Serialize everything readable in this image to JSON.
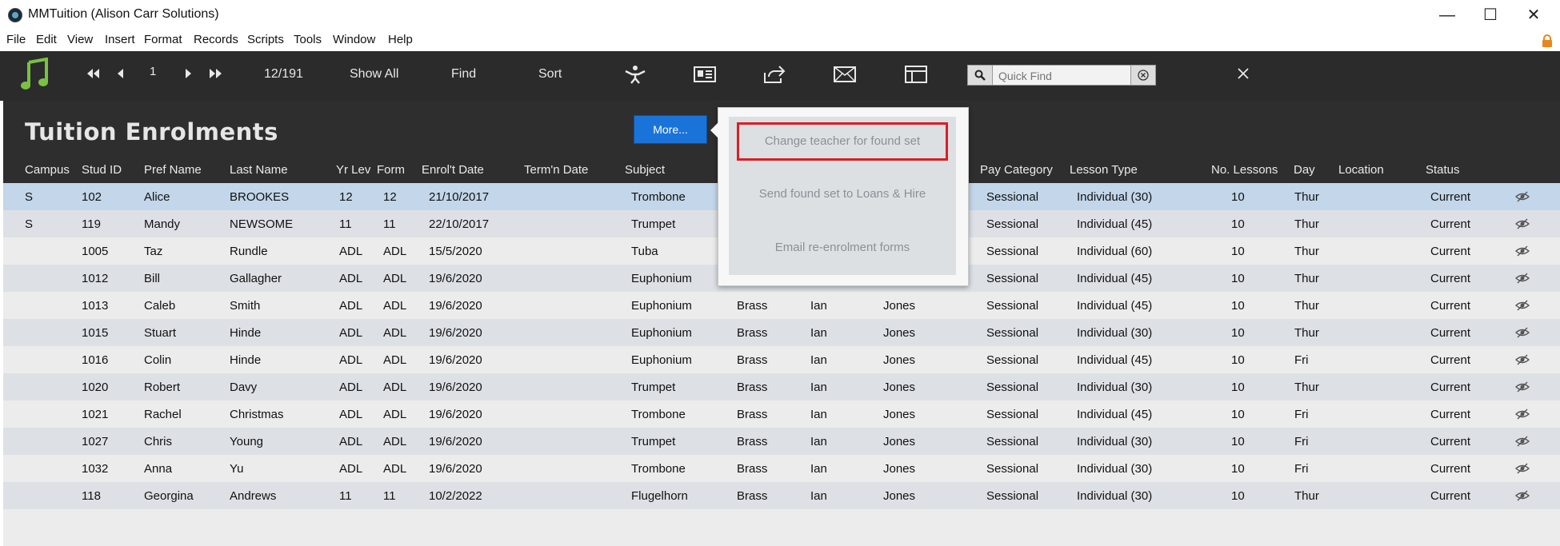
{
  "window": {
    "title": "MMTuition (Alison Carr Solutions)",
    "controls": {
      "minimize": "—",
      "maximize": "☐",
      "close": "✕"
    }
  },
  "menu": {
    "items": [
      "File",
      "Edit",
      "View",
      "Insert",
      "Format",
      "Records",
      "Scripts",
      "Tools",
      "Window",
      "Help"
    ]
  },
  "toolbar": {
    "record_number": "1",
    "record_count": "12/191",
    "show_all": "Show All",
    "find": "Find",
    "sort": "Sort",
    "search_placeholder": "Quick Find",
    "icons": [
      "music-note-icon",
      "first-record-icon",
      "previous-record-icon",
      "next-record-icon",
      "last-record-icon",
      "person-icon",
      "contact-card-icon",
      "share-icon",
      "mail-icon",
      "layout-icon",
      "search-icon",
      "clear-icon",
      "close-icon"
    ]
  },
  "page": {
    "title": "Tuition Enrolments",
    "more_button": "More..."
  },
  "columns": [
    "Campus",
    "Stud ID",
    "Pref Name",
    "Last Name",
    "Yr Lev",
    "Form",
    "Enrol't Date",
    "Term'n Date",
    "Subject",
    "Pay Category",
    "Lesson Type",
    "No. Lessons",
    "Day",
    "Location",
    "Status"
  ],
  "rows": [
    {
      "campus": "S",
      "stud_id": "102",
      "pref": "Alice",
      "last": "BROOKES",
      "yr": "12",
      "form": "12",
      "enrol": "21/10/2017",
      "term": "",
      "subject": "Trombone",
      "family": "",
      "tfirst": "",
      "tlast": "",
      "pay": "Sessional",
      "lesson": "Individual (30)",
      "num": "10",
      "day": "Thur",
      "location": "",
      "status": "Current"
    },
    {
      "campus": "S",
      "stud_id": "119",
      "pref": "Mandy",
      "last": "NEWSOME",
      "yr": "11",
      "form": "11",
      "enrol": "22/10/2017",
      "term": "",
      "subject": "Trumpet",
      "family": "",
      "tfirst": "",
      "tlast": "",
      "pay": "Sessional",
      "lesson": "Individual (45)",
      "num": "10",
      "day": "Thur",
      "location": "",
      "status": "Current"
    },
    {
      "campus": "",
      "stud_id": "1005",
      "pref": "Taz",
      "last": "Rundle",
      "yr": "ADL",
      "form": "ADL",
      "enrol": "15/5/2020",
      "term": "",
      "subject": "Tuba",
      "family": "",
      "tfirst": "",
      "tlast": "",
      "pay": "Sessional",
      "lesson": "Individual (60)",
      "num": "10",
      "day": "Thur",
      "location": "",
      "status": "Current"
    },
    {
      "campus": "",
      "stud_id": "1012",
      "pref": "Bill",
      "last": "Gallagher",
      "yr": "ADL",
      "form": "ADL",
      "enrol": "19/6/2020",
      "term": "",
      "subject": "Euphonium",
      "family": "",
      "tfirst": "",
      "tlast": "",
      "pay": "Sessional",
      "lesson": "Individual (45)",
      "num": "10",
      "day": "Thur",
      "location": "",
      "status": "Current"
    },
    {
      "campus": "",
      "stud_id": "1013",
      "pref": "Caleb",
      "last": "Smith",
      "yr": "ADL",
      "form": "ADL",
      "enrol": "19/6/2020",
      "term": "",
      "subject": "Euphonium",
      "family": "Brass",
      "tfirst": "Ian",
      "tlast": "Jones",
      "pay": "Sessional",
      "lesson": "Individual (45)",
      "num": "10",
      "day": "Thur",
      "location": "",
      "status": "Current"
    },
    {
      "campus": "",
      "stud_id": "1015",
      "pref": "Stuart",
      "last": "Hinde",
      "yr": "ADL",
      "form": "ADL",
      "enrol": "19/6/2020",
      "term": "",
      "subject": "Euphonium",
      "family": "Brass",
      "tfirst": "Ian",
      "tlast": "Jones",
      "pay": "Sessional",
      "lesson": "Individual (30)",
      "num": "10",
      "day": "Thur",
      "location": "",
      "status": "Current"
    },
    {
      "campus": "",
      "stud_id": "1016",
      "pref": "Colin",
      "last": "Hinde",
      "yr": "ADL",
      "form": "ADL",
      "enrol": "19/6/2020",
      "term": "",
      "subject": "Euphonium",
      "family": "Brass",
      "tfirst": "Ian",
      "tlast": "Jones",
      "pay": "Sessional",
      "lesson": "Individual (45)",
      "num": "10",
      "day": "Fri",
      "location": "",
      "status": "Current"
    },
    {
      "campus": "",
      "stud_id": "1020",
      "pref": "Robert",
      "last": "Davy",
      "yr": "ADL",
      "form": "ADL",
      "enrol": "19/6/2020",
      "term": "",
      "subject": "Trumpet",
      "family": "Brass",
      "tfirst": "Ian",
      "tlast": "Jones",
      "pay": "Sessional",
      "lesson": "Individual (30)",
      "num": "10",
      "day": "Thur",
      "location": "",
      "status": "Current"
    },
    {
      "campus": "",
      "stud_id": "1021",
      "pref": "Rachel",
      "last": "Christmas",
      "yr": "ADL",
      "form": "ADL",
      "enrol": "19/6/2020",
      "term": "",
      "subject": "Trombone",
      "family": "Brass",
      "tfirst": "Ian",
      "tlast": "Jones",
      "pay": "Sessional",
      "lesson": "Individual (45)",
      "num": "10",
      "day": "Fri",
      "location": "",
      "status": "Current"
    },
    {
      "campus": "",
      "stud_id": "1027",
      "pref": "Chris",
      "last": "Young",
      "yr": "ADL",
      "form": "ADL",
      "enrol": "19/6/2020",
      "term": "",
      "subject": "Trumpet",
      "family": "Brass",
      "tfirst": "Ian",
      "tlast": "Jones",
      "pay": "Sessional",
      "lesson": "Individual (30)",
      "num": "10",
      "day": "Fri",
      "location": "",
      "status": "Current"
    },
    {
      "campus": "",
      "stud_id": "1032",
      "pref": "Anna",
      "last": "Yu",
      "yr": "ADL",
      "form": "ADL",
      "enrol": "19/6/2020",
      "term": "",
      "subject": "Trombone",
      "family": "Brass",
      "tfirst": "Ian",
      "tlast": "Jones",
      "pay": "Sessional",
      "lesson": "Individual (30)",
      "num": "10",
      "day": "Fri",
      "location": "",
      "status": "Current"
    },
    {
      "campus": "",
      "stud_id": "118",
      "pref": "Georgina",
      "last": "Andrews",
      "yr": "11",
      "form": "11",
      "enrol": "10/2/2022",
      "term": "",
      "subject": "Flugelhorn",
      "family": "Brass",
      "tfirst": "Ian",
      "tlast": "Jones",
      "pay": "Sessional",
      "lesson": "Individual (30)",
      "num": "10",
      "day": "Thur",
      "location": "",
      "status": "Current"
    }
  ],
  "popover": {
    "items": [
      "Change teacher for found set",
      "Send found set to Loans & Hire",
      "Email re-enrolment forms"
    ]
  },
  "colors": {
    "toolbar_bg": "#2b2b2b",
    "header_bg": "#2e2e2e",
    "row_selected": "#c3d6ea",
    "row_alt": "#dde1e6",
    "row_plain": "#ececec",
    "accent_blue": "#1a73d9",
    "music_icon": "#7ac143",
    "highlight_red": "#e01b24",
    "lock_orange": "#e8871e"
  }
}
